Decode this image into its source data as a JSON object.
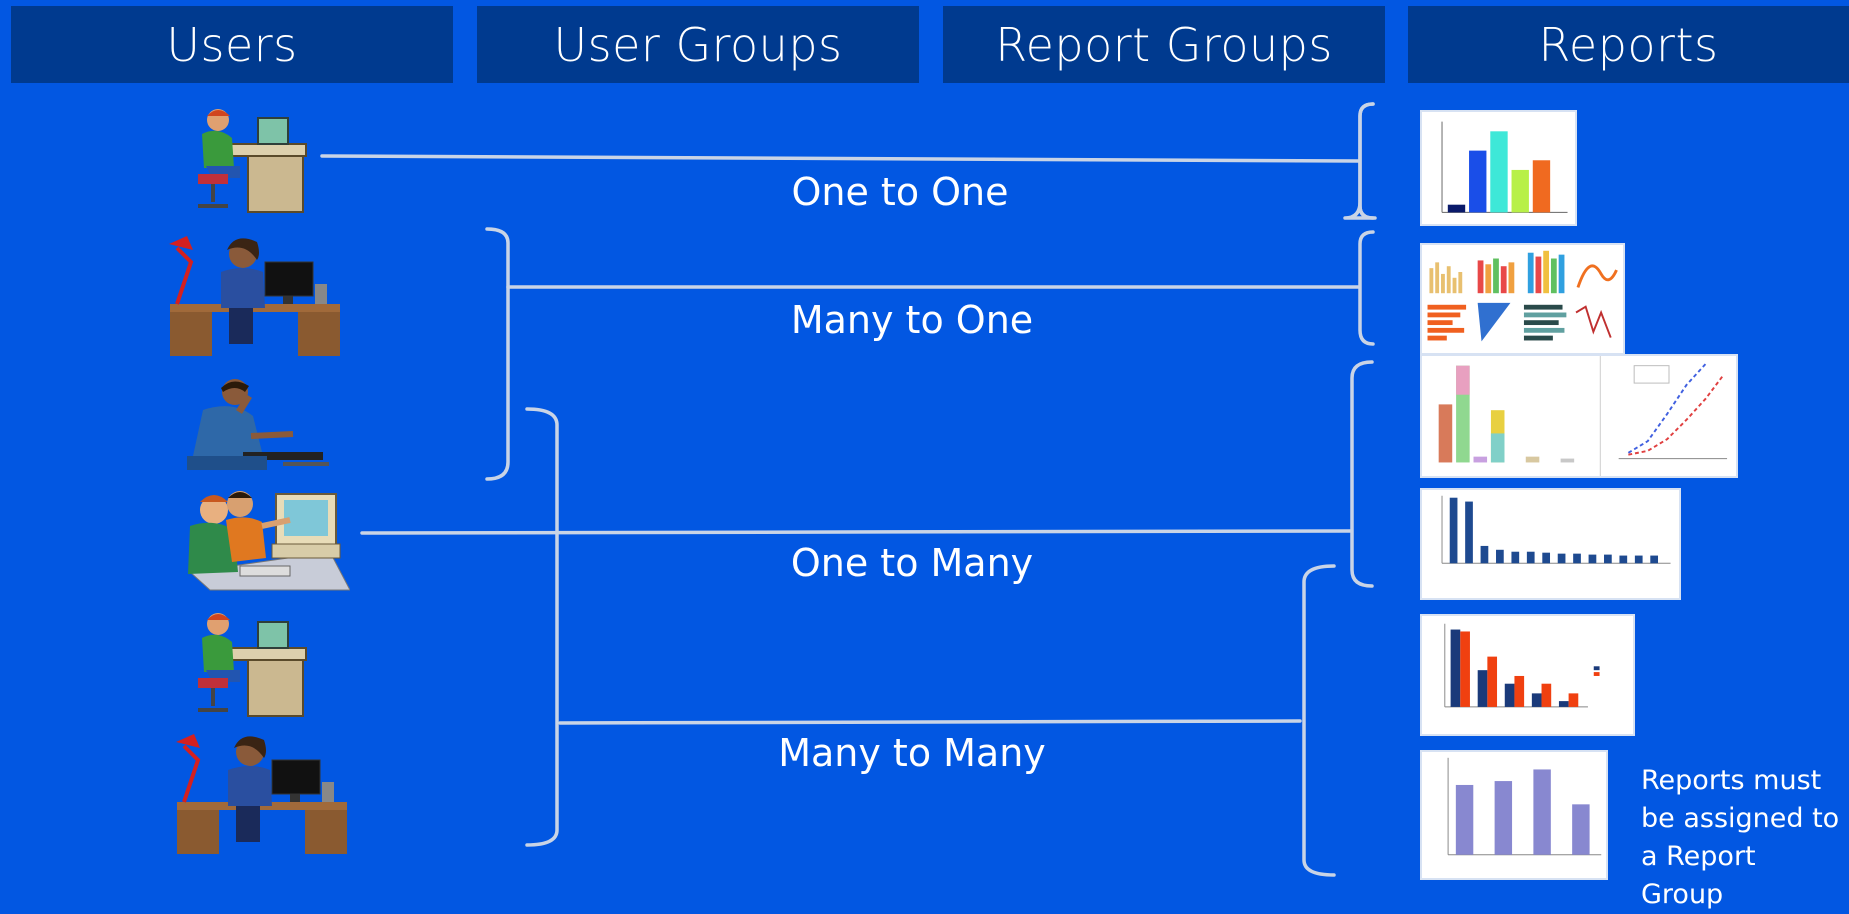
{
  "columns": {
    "users": "Users",
    "user_groups": "User Groups",
    "report_groups": "Report Groups",
    "reports": "Reports"
  },
  "relations": {
    "one_to_one": "One to One",
    "many_to_one": "Many to One",
    "one_to_many": "One to Many",
    "many_to_many": "Many to Many"
  },
  "note": "Reports must be assigned to a Report Group",
  "colors": {
    "background": "#0257e2",
    "header": "#003a8f",
    "connector": "#c9d4e6"
  }
}
